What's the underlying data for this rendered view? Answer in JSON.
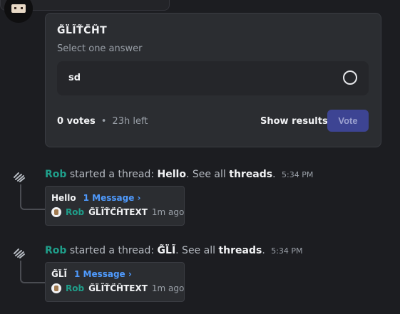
{
  "poll": {
    "question": "G̃L̈ĨT̃C̈H̃T",
    "subtitle": "Select one answer",
    "option_label": "sd",
    "votes": "0 votes",
    "time_left": "23h left",
    "show_results": "Show results",
    "vote_label": "Vote",
    "separator": "•"
  },
  "threads": [
    {
      "author": "Rob",
      "action": "started a thread:",
      "thread_name": "Hello",
      "see_all": ". See all",
      "threads_link": "threads",
      "period": ".",
      "time": "5:34 PM",
      "card_name": "Hello",
      "message_count": "1 Message ›",
      "last_author": "Rob",
      "last_text": "G̃L̈ĨT̃C̈H̃TEXT",
      "last_time": "1m ago"
    },
    {
      "author": "Rob",
      "action": "started a thread:",
      "thread_name": "G̃L̈Ĩ",
      "see_all": ". See all",
      "threads_link": "threads",
      "period": ".",
      "time": "5:34 PM",
      "card_name": "G̃L̈Ĩ",
      "message_count": "1 Message ›",
      "last_author": "Rob",
      "last_text": "G̃L̈ĨT̃C̈H̃TEXT",
      "last_time": "1m ago"
    }
  ],
  "colors": {
    "background": "#1c1d21",
    "card": "#2b2d31",
    "author": "#1f9e8a",
    "link": "#4f9bff",
    "vote_button": "#3d4493"
  },
  "icons": {
    "thread": "thread-icon",
    "radio": "radio-unselected-icon"
  }
}
